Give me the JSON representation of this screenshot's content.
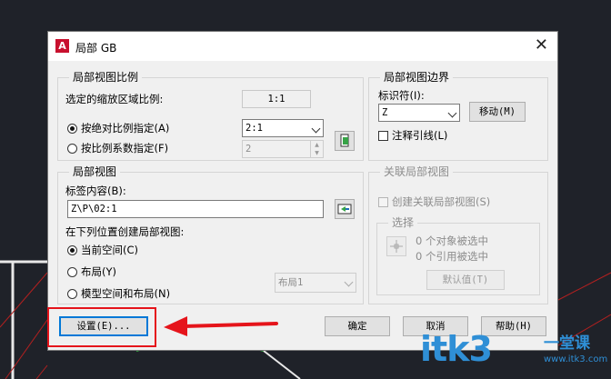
{
  "dialog": {
    "title": "局部 GB",
    "icon": "autocad-logo-icon",
    "close": "✕"
  },
  "scale_group": {
    "label": "局部视图比例",
    "selected_label": "选定的缩放区域比例:",
    "selected_value": "1:1",
    "absolute_radio": "按绝对比例指定(A)",
    "absolute_value": "2:1",
    "factor_radio": "按比例系数指定(F)",
    "factor_value": "2"
  },
  "border_group": {
    "label": "局部视图边界",
    "identifier_label": "标识符(I):",
    "identifier_value": "Z",
    "move_button": "移动(M)",
    "leader_checkbox": "注释引线(L)"
  },
  "view_group": {
    "label": "局部视图",
    "tag_label": "标签内容(B):",
    "tag_value": "Z\\P\\02:1",
    "location_label": "在下列位置创建局部视图:",
    "options": [
      "当前空间(C)",
      "布局(Y)",
      "模型空间和布局(N)"
    ],
    "layout_select": "布局1"
  },
  "assoc_group": {
    "label": "关联局部视图",
    "create_checkbox": "创建关联局部视图(S)",
    "select_label": "选择",
    "objects_selected": "0 个对象被选中",
    "refs_selected": "0 个引用被选中",
    "default_button": "默认值(T)"
  },
  "footer": {
    "settings": "设置(E)...",
    "ok": "确定",
    "cancel": "取消",
    "help": "帮助(H)"
  },
  "watermark": {
    "text": "itk3",
    "cn_top": "一堂课",
    "cn_bottom": "www.itk3.com"
  },
  "colors": {
    "accent": "#0078d7",
    "annotation_red": "#e5141b",
    "watermark": "#2f8fd6"
  }
}
